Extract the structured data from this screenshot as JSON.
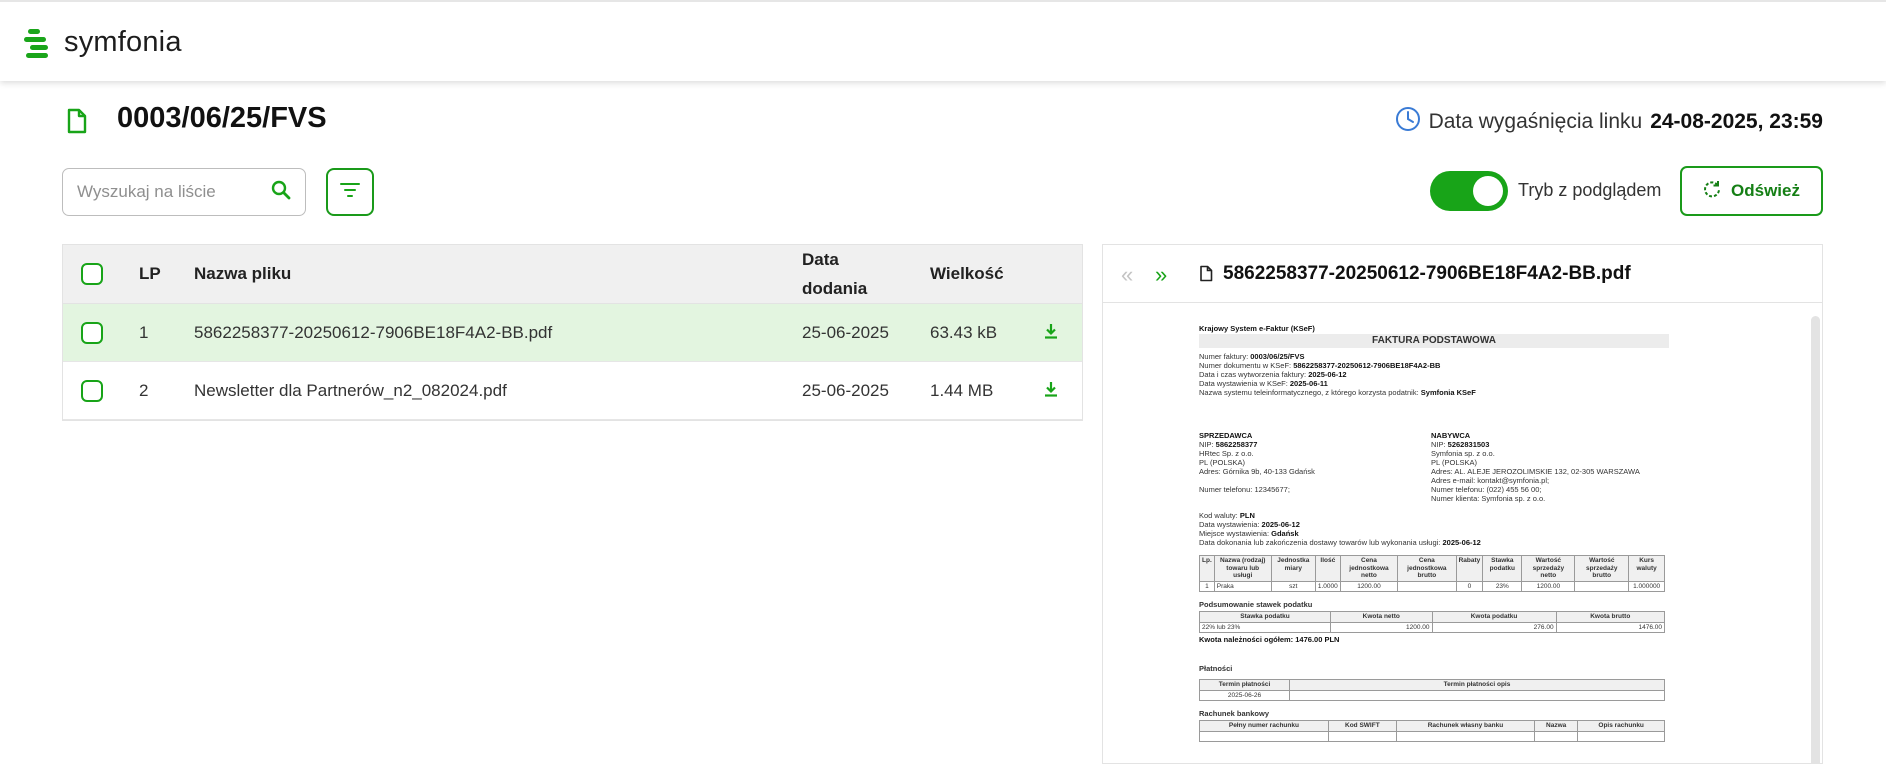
{
  "brand": {
    "name": "symfonia",
    "color": "#1aa51a"
  },
  "document": {
    "title": "0003/06/25/FVS",
    "expiry_label": "Data wygaśnięcia linku",
    "expiry_value": "24-08-2025, 23:59"
  },
  "toolbar": {
    "search_placeholder": "Wyszukaj na liście",
    "preview_toggle_label": "Tryb z podglądem",
    "preview_toggle_on": true,
    "refresh_label": "Odśwież"
  },
  "table": {
    "columns": {
      "lp": "LP",
      "name": "Nazwa pliku",
      "date_line1": "Data",
      "date_line2": "dodania",
      "size": "Wielkość"
    },
    "rows": [
      {
        "lp": "1",
        "name": "5862258377-20250612-7906BE18F4A2-BB.pdf",
        "date": "25-06-2025",
        "size": "63.43 kB",
        "selected": true
      },
      {
        "lp": "2",
        "name": "Newsletter dla Partnerów_n2_082024.pdf",
        "date": "25-06-2025",
        "size": "1.44 MB",
        "selected": false
      }
    ]
  },
  "preview": {
    "file_name": "5862258377-20250612-7906BE18F4A2-BB.pdf",
    "invoice": {
      "system": "Krajowy System e-Faktur (KSeF)",
      "heading": "FAKTURA PODSTAWOWA",
      "meta": [
        {
          "label": "Numer faktury: ",
          "value": "0003/06/25/FVS"
        },
        {
          "label": "Numer dokumentu w KSeF: ",
          "value": "5862258377-20250612-7906BE18F4A2-BB"
        },
        {
          "label": "Data i czas wytworzenia faktury: ",
          "value": "2025-06-12"
        },
        {
          "label": "Data wystawienia w KSeF: ",
          "value": "2025-06-11"
        },
        {
          "label": "Nazwa systemu teleinformatycznego, z którego korzysta podatnik: ",
          "value": "Symfonia KSeF"
        }
      ],
      "seller_title": "SPRZEDAWCA",
      "seller": [
        {
          "label": "NIP: ",
          "value": "5862258377"
        },
        {
          "label": "HRtec Sp. z o.o.",
          "value": ""
        },
        {
          "label": "PL (POLSKA)",
          "value": ""
        },
        {
          "label": "Adres: Górnika 9b, 40-133 Gdańsk",
          "value": ""
        },
        {
          "label": "",
          "value": ""
        },
        {
          "label": "Numer telefonu: 12345677;",
          "value": ""
        }
      ],
      "buyer_title": "NABYWCA",
      "buyer": [
        {
          "label": "NIP: ",
          "value": "5262831503"
        },
        {
          "label": "Symfonia sp. z o.o.",
          "value": ""
        },
        {
          "label": "PL (POLSKA)",
          "value": ""
        },
        {
          "label": "Adres: AL. ALEJE JEROZOLIMSKIE 132, 02-305 WARSZAWA",
          "value": ""
        },
        {
          "label": "Adres e-mail: kontakt@symfonia.pl;",
          "value": ""
        },
        {
          "label": "Numer telefonu: (022) 455 56 00;",
          "value": ""
        },
        {
          "label": "Numer klienta: Symfonia sp. z o.o.",
          "value": ""
        }
      ],
      "details": [
        {
          "label": "Kod waluty: ",
          "value": "PLN"
        },
        {
          "label": "Data wystawienia: ",
          "value": "2025-06-12"
        },
        {
          "label": "Miejsce wystawienia: ",
          "value": "Gdańsk"
        },
        {
          "label": "Data dokonania lub zakończenia dostawy towarów lub wykonania usługi: ",
          "value": "2025-06-12"
        }
      ],
      "items_headers": [
        "Lp.",
        "Nazwa (rodzaj) towaru lub usługi",
        "Jednostka miary",
        "Ilość",
        "Cena jednostkowa netto",
        "Cena jednostkowa brutto",
        "Rabaty",
        "Stawka podatku",
        "Wartość sprzedaży netto",
        "Wartość sprzedaży brutto",
        "Kurs waluty"
      ],
      "items_row": [
        "1",
        "Praka",
        "szt",
        "1.0000",
        "1200.00",
        "",
        "0",
        "23%",
        "1200.00",
        "",
        "1.000000"
      ],
      "vat_title": "Podsumowanie stawek podatku",
      "vat_headers": [
        "Stawka podatku",
        "Kwota netto",
        "Kwota podatku",
        "Kwota brutto"
      ],
      "vat_row": [
        "22% lub 23%",
        "1200.00",
        "276.00",
        "1476.00"
      ],
      "total": "Kwota należności ogółem: 1476.00 PLN",
      "payment_title": "Płatności",
      "payment_headers": [
        "Termin płatności",
        "Termin płatności opis"
      ],
      "payment_row": [
        "2025-06-26",
        ""
      ],
      "bank_title": "Rachunek bankowy",
      "bank_headers": [
        "Pełny numer rachunku",
        "Kod SWIFT",
        "Rachunek własny banku",
        "Nazwa",
        "Opis rachunku"
      ]
    }
  }
}
